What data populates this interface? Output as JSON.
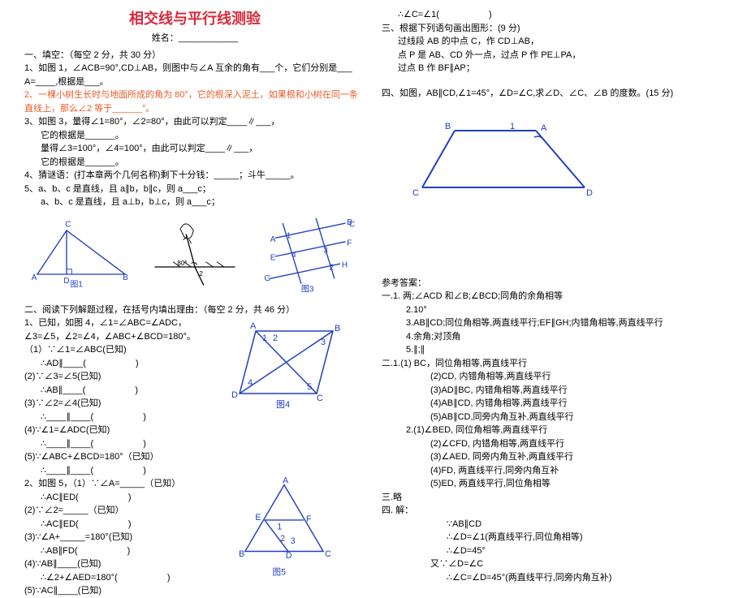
{
  "title": "相交线与平行线测验",
  "name_prefix": "姓名：",
  "sec1_head": "一、填空：（每空 2 分，共 30 分）",
  "q1": "1、如图 1，∠ACB=90°,CD⊥AB，则图中与∠A 互余的角有___个，它们分别是___",
  "q1b": "A=____,根据是___。",
  "q2": "2、一棵小树生长时与地面所成的角为 80°，它的根深入泥土，如果根和小树在同一条直线上，那么∠2 等于______°。",
  "q3_1": "3、如图 3，量得∠1=80°，∠2=80°，由此可以判定____∥___，",
  "q3_2": "它的根据是______。",
  "q3_3": "量得∠3=100°，∠4=100°，由此可以判定____∥___，",
  "q3_4": "它的根据是______。",
  "q4": "4、猜谜语：(打本章两个几何名称)剩下十分钱：_____；斗牛_____。",
  "q5_1": "5、a、b、c 是直线，且 a∥b，b∥c，则 a___c；",
  "q5_2": "a、b、c 是直线，且 a⊥b，b⊥c，则 a___c；",
  "sec2_head": "二、阅读下列解题过程，在括号内填出理由：（每空 2 分，共 46 分）",
  "p2_1": "1、已知，如图 4，∠1=∠ABC=∠ADC，∠3=∠5，∠2=∠4，∠ABC+∠BCD=180°。",
  "p2_1_1": "（1）∵∠1=∠ABC(已知)",
  "p2_1_2": "∴AD∥____(                    )",
  "p2_1_3": "(2)∵∠3=∠5(已知)",
  "p2_1_4": "∴AB∥____(                    )",
  "p2_1_5": "(3)∵∠2=∠4(已知)",
  "p2_1_6": "∴____∥____(                    )",
  "p2_1_7": "(4)∵∠1=∠ADC(已知)",
  "p2_1_8": "∴____∥____(                    )",
  "p2_1_9": "(5)∵∠ABC+∠BCD=180°（已知）",
  "p2_1_10": "∴____∥____(                    )",
  "p2_2": "2、如图 5，（1）∵∠A=_____（已知）",
  "p2_2_1": "∴AC∥ED(                    )",
  "p2_2_2": "(2)∵∠2=_____（已知）",
  "p2_2_3": "∴AC∥ED(                    )",
  "p2_2_4": "(3)∵∠A+_____=180°(已知)",
  "p2_2_5": "∴AB∥FD(                    )",
  "p2_2_6": "(4)∵AB∥____(已知)",
  "p2_2_7": "∴∠2+∠AED=180°(                    )",
  "p2_2_8": "(5)∵AC∥____(已知)",
  "r1": "∴∠C=∠1(",
  "sec3_head": "三、根据下列语句画出图形：(9 分)",
  "s3_1": "过线段 AB 的中点 C，作 CD⊥AB，",
  "s3_2": "点 P 是 AB、CD 外一点，过点 P 作 PE⊥PA，",
  "s3_3": "过点 B 作 BF∥AP；",
  "sec4_head": "四、如图，AB∥CD,∠1=45°，∠D=∠C,求∠D、∠C、∠B 的度数。(15 分)",
  "ans_head": "参考答案：",
  "a1_1": "一.1. 两;∠ACD 和∠B;∠BCD;同角的余角相等",
  "a1_2": "2.10°",
  "a1_3": "3.AB∥CD;同位角相等,两直线平行;EF∥GH;内错角相等,两直线平行",
  "a1_4": "4.余角;对顶角",
  "a1_5": "5.∥;∥",
  "a2_h": "二.1.(1) BC，同位角相等,两直线平行",
  "a2_2": "(2)CD, 内错角相等,两直线平行",
  "a2_3": "(3)AD∥BC, 内错角相等,两直线平行",
  "a2_4": "(4)AB∥CD, 内错角相等,两直线平行",
  "a2_5": "(5)AB∥CD,同旁内角互补,两直线平行",
  "a2_2h": "2.(1)∠BED, 同位角相等,两直线平行",
  "a2_2_2": "(2)∠CFD, 内错角相等,两直线平行",
  "a2_2_3": "(3)∠AED, 同旁内角互补,两直线平行",
  "a2_2_4": "(4)FD, 两直线平行,同旁内角互补",
  "a2_2_5": "(5)ED, 两直线平行,同位角相等",
  "a3": "三.略",
  "a4_h": "四. 解：",
  "a4_1": "∵AB∥CD",
  "a4_2": "∴∠D=∠1(两直线平行,同位角相等)",
  "a4_3": "∴∠D=45°",
  "a4_4": "又∵∠D=∠C",
  "a4_5": "∴∠C=∠D=45°(两直线平行,同旁内角互补)",
  "fig1_label": "图1",
  "fig3_label": "图3",
  "fig4_label": "图4",
  "fig5_label": "图5"
}
